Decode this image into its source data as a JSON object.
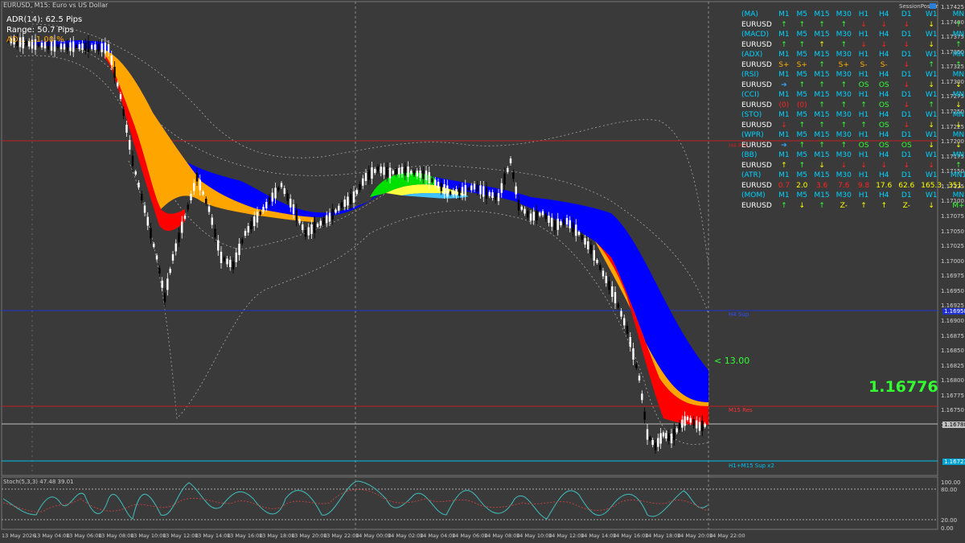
{
  "window": {
    "title": "EURUSD, M15: Euro vs US Dollar",
    "session_label": "SessionPoster"
  },
  "info": {
    "adr": "ADR(14): 62.5 Pips",
    "range": "Range: 50.7 Pips",
    "adr_extra": "AD... ...1 00 %"
  },
  "price_axis": {
    "ticks": [
      "1.17425",
      "1.17400",
      "1.17375",
      "1.17350",
      "1.17325",
      "1.17300",
      "1.17275",
      "1.17250",
      "1.17225",
      "1.17200",
      "1.17175",
      "1.17150",
      "1.17125",
      "1.17100",
      "1.17075",
      "1.17050",
      "1.17025",
      "1.17000",
      "1.16975",
      "1.16950",
      "1.16925",
      "1.16900",
      "1.16875",
      "1.16850",
      "1.16825",
      "1.16800",
      "1.16775",
      "1.16750",
      "1.16725"
    ],
    "current_price_box": "1.16788",
    "h4_sup_box": "1.16958",
    "h1m15_box": "1.16723"
  },
  "levels": {
    "h4_sup_label": "H4 Sup",
    "h4_res_label": "H4 Res",
    "m15_res_label": "M15 Res",
    "h1m15_sup_label": "H1+M15 Sup x2",
    "pips_label": "< 13.00",
    "big_price": "1.16776"
  },
  "stoch": {
    "label": "Stoch(5,3,3) 47.48 39.01",
    "axis": [
      "100.00",
      "80.00",
      "20.00",
      "0.00"
    ]
  },
  "time_axis": [
    "13 May 2026",
    "13 May 04:00",
    "13 May 06:00",
    "13 May 08:00",
    "13 May 10:00",
    "13 May 12:00",
    "13 May 14:00",
    "13 May 16:00",
    "13 May 18:00",
    "13 May 20:00",
    "13 May 22:00",
    "14 May 00:00",
    "14 May 02:00",
    "14 May 04:00",
    "14 May 06:00",
    "14 May 08:00",
    "14 May 10:00",
    "14 May 12:00",
    "14 May 14:00",
    "14 May 16:00",
    "14 May 18:00",
    "14 May 20:00",
    "14 May 22:00"
  ],
  "dashboard": {
    "rows": [
      {
        "type": "head",
        "label": "(MA)",
        "cells": [
          "M1",
          "M5",
          "M15",
          "M30",
          "H1",
          "H4",
          "D1",
          "W1",
          "MN"
        ]
      },
      {
        "type": "pair",
        "label": "EURUSD",
        "cells": [
          [
            "↑",
            "up"
          ],
          [
            "↑",
            "up"
          ],
          [
            "↑",
            "up"
          ],
          [
            "↑",
            "up"
          ],
          [
            "↓",
            "dn"
          ],
          [
            "↓",
            "dn"
          ],
          [
            "↓",
            "dn"
          ],
          [
            "↓",
            "yl"
          ],
          [
            "↑",
            "up"
          ]
        ]
      },
      {
        "type": "head",
        "label": "(MACD)",
        "cells": [
          "M1",
          "M5",
          "M15",
          "M30",
          "H1",
          "H4",
          "D1",
          "W1",
          "MN"
        ]
      },
      {
        "type": "pair",
        "label": "EURUSD",
        "cells": [
          [
            "↑",
            "up"
          ],
          [
            "↑",
            "up"
          ],
          [
            "↑",
            "yl"
          ],
          [
            "↑",
            "up"
          ],
          [
            "↓",
            "dn"
          ],
          [
            "↓",
            "dn"
          ],
          [
            "↓",
            "dn"
          ],
          [
            "↓",
            "yl"
          ],
          [
            "↑",
            "up"
          ]
        ]
      },
      {
        "type": "head",
        "label": "(ADX)",
        "cells": [
          "M1",
          "M5",
          "M15",
          "M30",
          "H1",
          "H4",
          "D1",
          "W1",
          "MN"
        ]
      },
      {
        "type": "pair",
        "label": "EURUSD",
        "cells": [
          [
            "S+",
            "or"
          ],
          [
            "S+",
            "or"
          ],
          [
            "↑",
            "up"
          ],
          [
            "S+",
            "or"
          ],
          [
            "S-",
            "or"
          ],
          [
            "S-",
            "or"
          ],
          [
            "↓",
            "dn"
          ],
          [
            "↑",
            "up"
          ],
          [
            "↑",
            "up"
          ]
        ]
      },
      {
        "type": "head",
        "label": "(RSI)",
        "cells": [
          "M1",
          "M5",
          "M15",
          "M30",
          "H1",
          "H4",
          "D1",
          "W1",
          "MN"
        ]
      },
      {
        "type": "pair",
        "label": "EURUSD",
        "cells": [
          [
            "➔",
            "bl"
          ],
          [
            "↑",
            "up"
          ],
          [
            "↑",
            "up"
          ],
          [
            "↑",
            "up"
          ],
          [
            "OS",
            "up"
          ],
          [
            "OS",
            "up"
          ],
          [
            "↓",
            "dn"
          ],
          [
            "↓",
            "yl"
          ],
          [
            "↓",
            "yl"
          ]
        ]
      },
      {
        "type": "head",
        "label": "(CCI)",
        "cells": [
          "M1",
          "M5",
          "M15",
          "M30",
          "H1",
          "H4",
          "D1",
          "W1",
          "MN"
        ]
      },
      {
        "type": "pair",
        "label": "EURUSD",
        "cells": [
          [
            "(0)",
            "dn"
          ],
          [
            "(0)",
            "dn"
          ],
          [
            "↑",
            "up"
          ],
          [
            "↑",
            "up"
          ],
          [
            "↑",
            "up"
          ],
          [
            "OS",
            "up"
          ],
          [
            "↓",
            "dn"
          ],
          [
            "↑",
            "up"
          ],
          [
            "↓",
            "yl"
          ]
        ]
      },
      {
        "type": "head",
        "label": "(STO)",
        "cells": [
          "M1",
          "M5",
          "M15",
          "M30",
          "H1",
          "H4",
          "D1",
          "W1",
          "MN"
        ]
      },
      {
        "type": "pair",
        "label": "EURUSD",
        "cells": [
          [
            "↓",
            "dn"
          ],
          [
            "↑",
            "up"
          ],
          [
            "↑",
            "up"
          ],
          [
            "↑",
            "up"
          ],
          [
            "↑",
            "up"
          ],
          [
            "OS",
            "up"
          ],
          [
            "↓",
            "dn"
          ],
          [
            "↓",
            "yl"
          ],
          [
            "↓",
            "yl"
          ]
        ]
      },
      {
        "type": "head",
        "label": "(WPR)",
        "cells": [
          "M1",
          "M5",
          "M15",
          "M30",
          "H1",
          "H4",
          "D1",
          "W1",
          "MN"
        ]
      },
      {
        "type": "pair",
        "label": "EURUSD",
        "cells": [
          [
            "➔",
            "bl"
          ],
          [
            "↑",
            "up"
          ],
          [
            "↑",
            "up"
          ],
          [
            "↑",
            "up"
          ],
          [
            "OS",
            "up"
          ],
          [
            "OS",
            "up"
          ],
          [
            "OS",
            "up"
          ],
          [
            "↓",
            "yl"
          ],
          [
            "↓",
            "yl"
          ]
        ]
      },
      {
        "type": "head",
        "label": "(BB)",
        "cells": [
          "M1",
          "M5",
          "M15",
          "M30",
          "H1",
          "H4",
          "D1",
          "W1",
          "MN"
        ]
      },
      {
        "type": "pair",
        "label": "EURUSD",
        "cells": [
          [
            "↑",
            "yl"
          ],
          [
            "↑",
            "up"
          ],
          [
            "↓",
            "yl"
          ],
          [
            "↓",
            "dn"
          ],
          [
            "↓",
            "dn"
          ],
          [
            "↓",
            "dn"
          ],
          [
            "↓",
            "dn"
          ],
          [
            "↓",
            "dn"
          ],
          [
            "↑",
            "up"
          ]
        ]
      },
      {
        "type": "head",
        "label": "(ATR)",
        "cells": [
          "M1",
          "M5",
          "M15",
          "M30",
          "H1",
          "H4",
          "D1",
          "W1",
          "MN1"
        ]
      },
      {
        "type": "pair",
        "label": "EURUSD",
        "cells": [
          [
            "0.7",
            "dn"
          ],
          [
            "2.0",
            "yl"
          ],
          [
            "3.6",
            "dn"
          ],
          [
            "7.6",
            "dn"
          ],
          [
            "9.8",
            "dn"
          ],
          [
            "17.6",
            "yl"
          ],
          [
            "62.6",
            "yl"
          ],
          [
            "165.3",
            "yl"
          ],
          [
            "351.5",
            "yl"
          ]
        ]
      },
      {
        "type": "head",
        "label": "(MOM)",
        "cells": [
          "M1",
          "M5",
          "M15",
          "M30",
          "H1",
          "H4",
          "D1",
          "W1",
          "MN"
        ]
      },
      {
        "type": "pair",
        "label": "EURUSD",
        "cells": [
          [
            "↑",
            "up"
          ],
          [
            "↓",
            "yl"
          ],
          [
            "↑",
            "up"
          ],
          [
            "Z-",
            "yl"
          ],
          [
            "↑",
            "yl"
          ],
          [
            "↑",
            "yl"
          ],
          [
            "Z-",
            "yl"
          ],
          [
            "↓",
            "yl"
          ],
          [
            "M+",
            "up"
          ]
        ]
      }
    ]
  },
  "colors": {
    "background": "#3a3a3a",
    "bull_candle": "#ffffff",
    "bear_candle": "#000000",
    "ribbon_blue": "#0000ff",
    "ribbon_orange": "#ffa500",
    "ribbon_red": "#ff0000",
    "ribbon_green": "#00e000",
    "h4_sup_line": "#2030d0",
    "res_line": "#c02020",
    "h1m15_line": "#00c0f0",
    "price_line": "#c0c0c0",
    "big_price": "#33ff33"
  }
}
